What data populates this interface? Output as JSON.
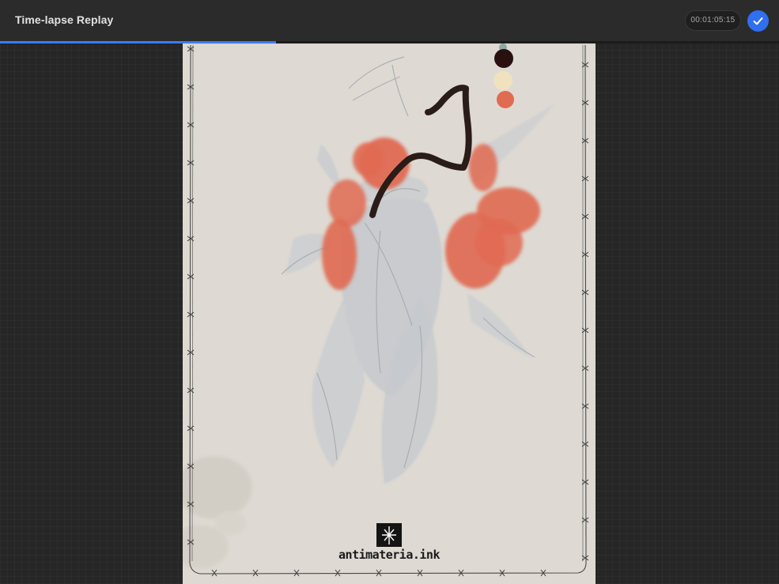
{
  "header": {
    "title": "Time-lapse Replay",
    "timecode": "00:01:05:15"
  },
  "playback": {
    "progress_fraction": 0.354
  },
  "artwork": {
    "watermark_text": "antimateria.ink"
  },
  "colors": {
    "accent": "#2f6ff0",
    "progress": "#3b7bf5",
    "paper": "#dedad3",
    "coral": "#e06a52",
    "ink": "#2a1c18"
  },
  "icons": {
    "done": "checkmark-icon"
  }
}
